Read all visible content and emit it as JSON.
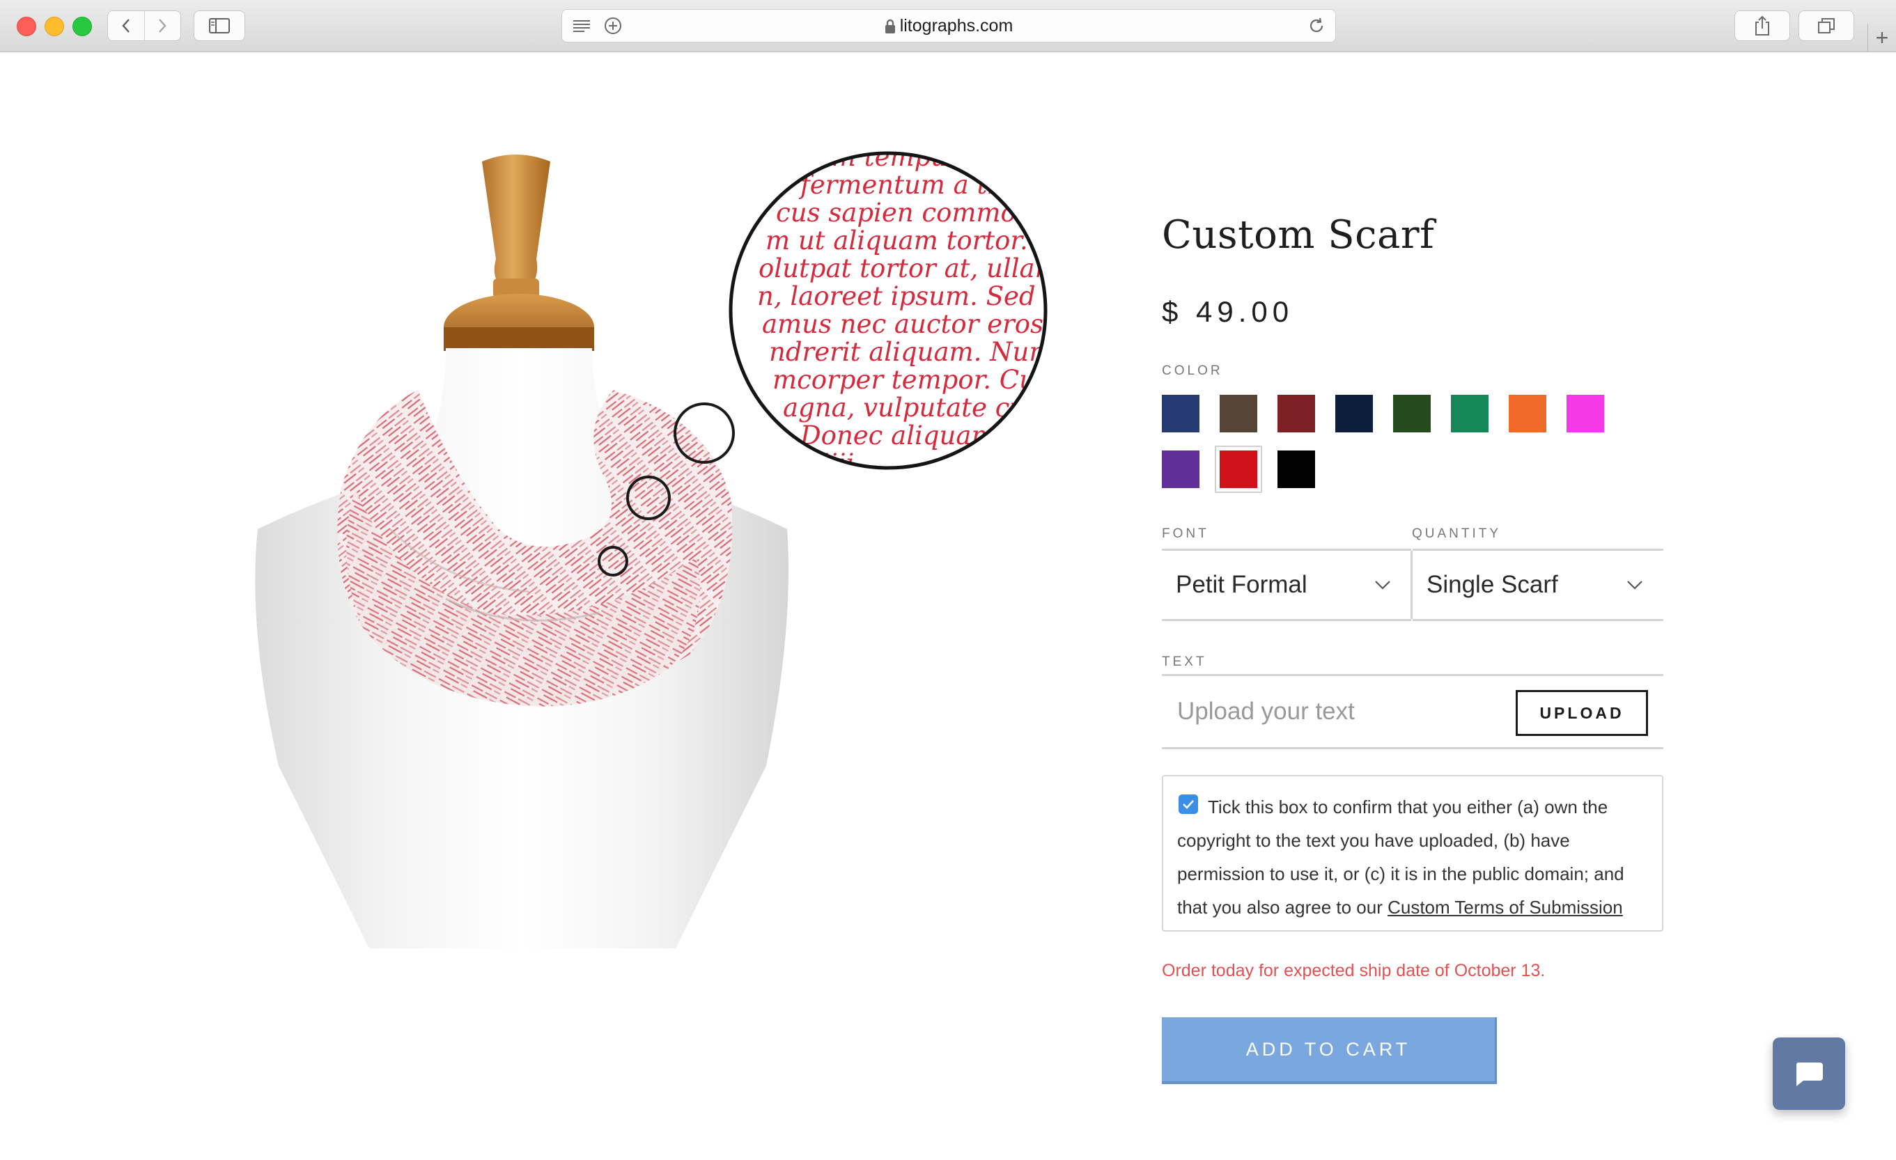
{
  "browser": {
    "url": "litographs.com"
  },
  "product": {
    "title": "Custom Scarf",
    "price": "$ 49.00",
    "magnifier_lines": [
      "tm tempus p",
      "fermentum a tinc",
      "cus sapien commodo, s",
      "m ut aliquam tortor. Pr",
      "olutpat tortor at, ullamcor",
      "n, laoreet ipsum. Sed tristiq",
      "amus nec auctor eros. Nul",
      "ndrerit aliquam. Nunc po",
      "mcorper tempor. Curabit",
      "agna, vulputate cur",
      "Donec aliquam",
      "iiii"
    ]
  },
  "color": {
    "label": "COLOR",
    "swatches": [
      {
        "name": "navy",
        "hex": "#263a74"
      },
      {
        "name": "brown",
        "hex": "#564536"
      },
      {
        "name": "maroon",
        "hex": "#7b2025"
      },
      {
        "name": "midnight",
        "hex": "#0d1d3c"
      },
      {
        "name": "forest",
        "hex": "#244a1d"
      },
      {
        "name": "green",
        "hex": "#168857"
      },
      {
        "name": "orange",
        "hex": "#f06a2a"
      },
      {
        "name": "magenta",
        "hex": "#f639e8"
      },
      {
        "name": "purple",
        "hex": "#612f97"
      },
      {
        "name": "red",
        "hex": "#d0131b"
      },
      {
        "name": "black",
        "hex": "#020202"
      }
    ],
    "selected": "red"
  },
  "font": {
    "label": "FONT",
    "value": "Petit Formal"
  },
  "quantity": {
    "label": "QUANTITY",
    "value": "Single Scarf"
  },
  "text": {
    "label": "TEXT",
    "placeholder": "Upload your text",
    "upload_label": "UPLOAD"
  },
  "consent": {
    "checked": true,
    "text": "Tick this box to confirm that you either (a) own the copyright to the text you have uploaded, (b) have permission to use it, or (c) it is in the public domain; and that you also agree to our ",
    "link": "Custom Terms of Submission"
  },
  "shipping_note": "Order today for expected ship date of October 13.",
  "cart_label": "ADD TO CART",
  "colors": {
    "accent_blue": "#7aa7dd",
    "ship_red": "#e05252",
    "chat_bg": "#6279a3",
    "scarf_text_red": "#d42a3b"
  }
}
